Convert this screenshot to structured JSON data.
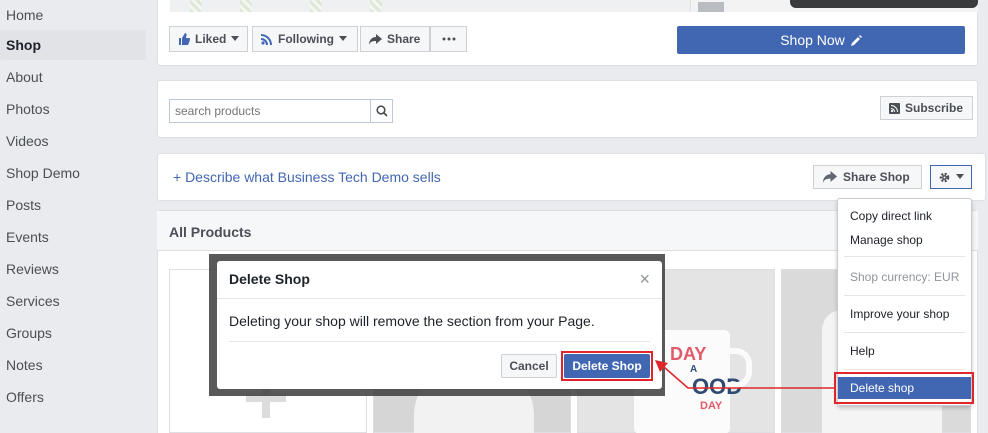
{
  "sidebar": {
    "items": [
      {
        "label": "Home"
      },
      {
        "label": "Shop",
        "active": true
      },
      {
        "label": "About"
      },
      {
        "label": "Photos"
      },
      {
        "label": "Videos"
      },
      {
        "label": "Shop Demo"
      },
      {
        "label": "Posts"
      },
      {
        "label": "Events"
      },
      {
        "label": "Reviews"
      },
      {
        "label": "Services"
      },
      {
        "label": "Groups"
      },
      {
        "label": "Notes"
      },
      {
        "label": "Offers"
      }
    ]
  },
  "actions": {
    "liked": "Liked",
    "following": "Following",
    "share": "Share",
    "shop_now": "Shop Now"
  },
  "search": {
    "placeholder": "search products",
    "subscribe": "Subscribe"
  },
  "describe": {
    "text": "+ Describe what Business Tech Demo sells",
    "share_shop": "Share Shop"
  },
  "products": {
    "heading": "All Products"
  },
  "menu": {
    "copy_link": "Copy direct link",
    "manage": "Manage shop",
    "currency": "Shop currency: EUR",
    "improve": "Improve your shop",
    "help": "Help",
    "delete": "Delete shop"
  },
  "dialog": {
    "title": "Delete Shop",
    "close": "×",
    "body": "Deleting your shop will remove the section from your Page.",
    "cancel": "Cancel",
    "confirm": "Delete Shop"
  },
  "mug": {
    "line1": "DAY",
    "line2": "A",
    "line3": "OOD",
    "line4": "DAY"
  },
  "colors": {
    "accent": "#4267b2",
    "highlight": "#e0262b"
  }
}
